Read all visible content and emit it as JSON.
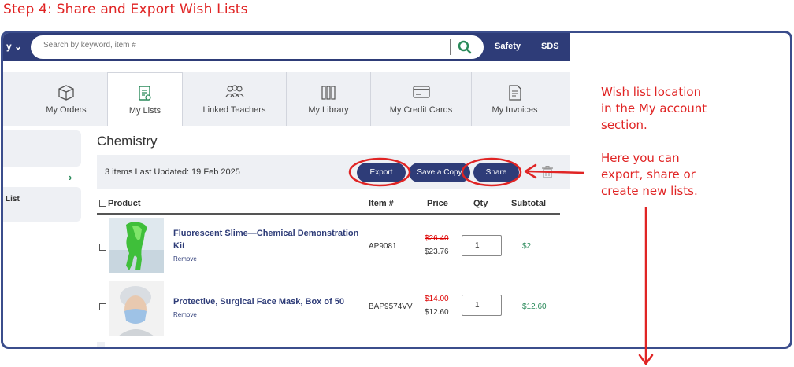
{
  "step_title": "Step 4: Share and Export Wish Lists",
  "header": {
    "category_label": "y",
    "search_placeholder": "Search by keyword, item #",
    "links": [
      "Safety",
      "SDS"
    ]
  },
  "tabs": [
    {
      "label": "My Orders",
      "icon": "box-icon"
    },
    {
      "label": "My Lists",
      "icon": "list-document-icon",
      "active": true
    },
    {
      "label": "Linked Teachers",
      "icon": "people-icon"
    },
    {
      "label": "My Library",
      "icon": "books-icon"
    },
    {
      "label": "My Credit Cards",
      "icon": "credit-card-icon"
    },
    {
      "label": "My Invoices",
      "icon": "invoice-icon"
    }
  ],
  "sidebar": {
    "chevron": "›",
    "item_label": "List"
  },
  "list": {
    "title": "Chemistry",
    "summary": "3 items  Last Updated: 19 Feb 2025",
    "buttons": {
      "export": "Export",
      "save_copy": "Save a Copy",
      "share": "Share"
    }
  },
  "table": {
    "headers": {
      "product": "Product",
      "item": "Item #",
      "price": "Price",
      "qty": "Qty",
      "subtotal": "Subtotal"
    },
    "rows": [
      {
        "name": "Fluorescent Slime—Chemical Demonstration Kit",
        "remove": "Remove",
        "item": "AP9081",
        "old_price": "$26.40",
        "price": "$23.76",
        "qty": "1",
        "subtotal": "$2"
      },
      {
        "name": "Protective, Surgical Face Mask, Box of 50",
        "remove": "Remove",
        "item": "BAP9574VV",
        "old_price": "$14.00",
        "price": "$12.60",
        "qty": "1",
        "subtotal": "$12.60"
      }
    ]
  },
  "annotations": {
    "location_note": [
      "Wish list location",
      "in the My account",
      "section."
    ],
    "actions_note": [
      "Here you can",
      "export, share or",
      "create new lists."
    ]
  },
  "colors": {
    "brand_navy": "#2e3c78",
    "annotation_red": "#e02424",
    "price_green": "#2a8a5a"
  }
}
